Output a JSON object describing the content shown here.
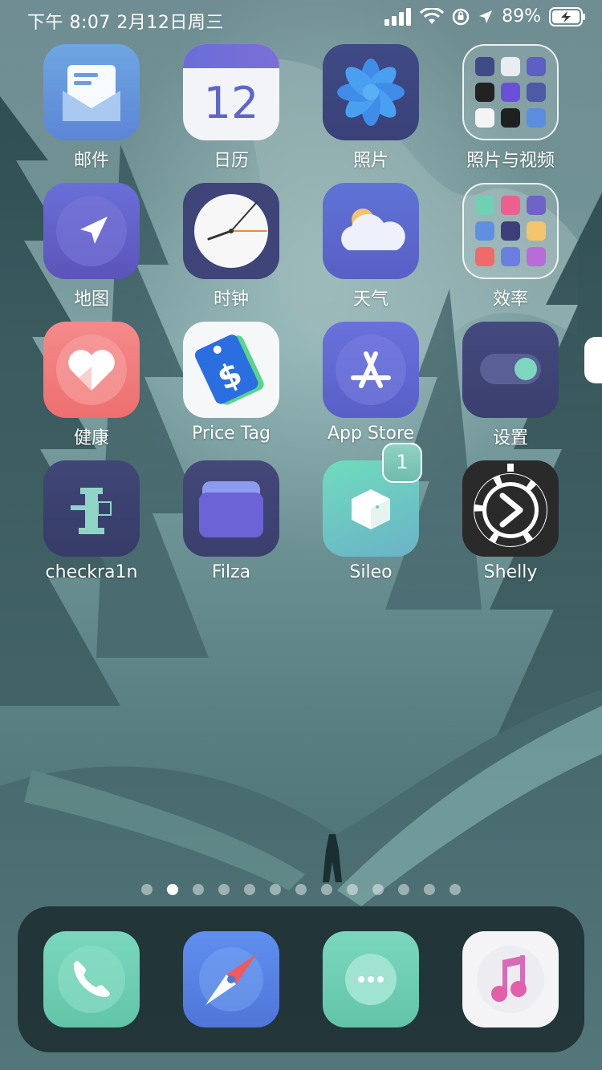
{
  "status_bar": {
    "time_date": "下午 8:07    2月12日周三",
    "battery_percent": "89%",
    "icons": [
      "signal-icon",
      "wifi-icon",
      "rotation-lock-icon",
      "location-icon",
      "battery-charging-icon"
    ]
  },
  "apps": [
    {
      "label": "邮件"
    },
    {
      "label": "日历",
      "day": "12"
    },
    {
      "label": "照片"
    },
    {
      "label": "照片与视频"
    },
    {
      "label": "地图"
    },
    {
      "label": "时钟"
    },
    {
      "label": "天气"
    },
    {
      "label": "效率"
    },
    {
      "label": "健康"
    },
    {
      "label": "Price Tag"
    },
    {
      "label": "App Store"
    },
    {
      "label": "设置"
    },
    {
      "label": "checkra1n"
    },
    {
      "label": "Filza"
    },
    {
      "label": "Sileo",
      "badge": "1"
    },
    {
      "label": "Shelly"
    }
  ],
  "page_dots": {
    "count": 13,
    "active_index": 1
  },
  "dock": [
    "phone",
    "safari",
    "messages",
    "music"
  ],
  "colors": {
    "accent": "#5a67c9",
    "mint": "#6fd0b4",
    "badge": "#7fc9b8"
  }
}
